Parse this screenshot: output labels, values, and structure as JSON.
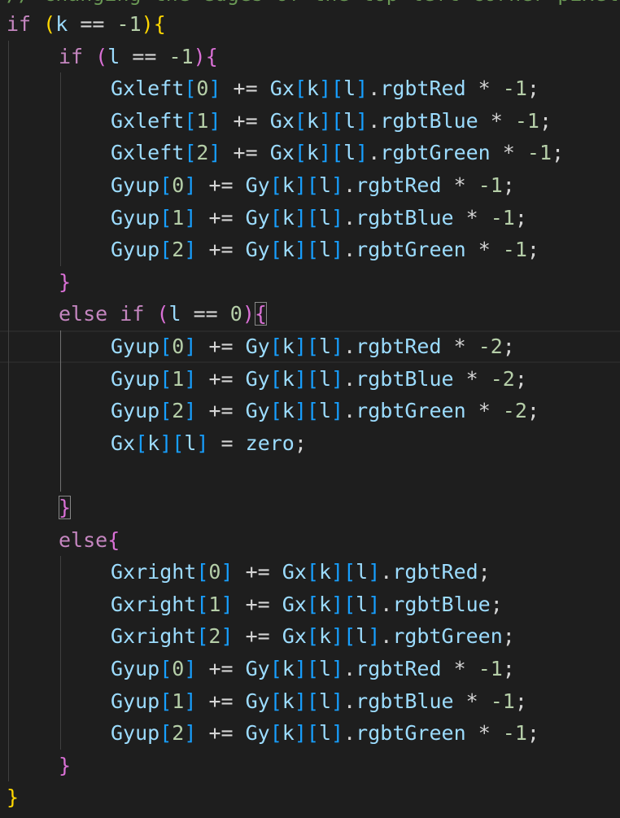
{
  "editor": {
    "top_comment": "// changing the edges of the top left corner pixel to be equal to zero",
    "colors": {
      "background": "#1e1e1e",
      "keyword_control": "#c586c0",
      "variable": "#9cdcfe",
      "number": "#b5cea8",
      "bracket_level_1": "#ffd700",
      "bracket_level_2": "#da70d6",
      "bracket_level_3": "#179fff"
    },
    "lines": [
      [
        [
          "if",
          "kw-ctrl"
        ],
        [
          " ",
          "op"
        ],
        [
          "(",
          "b1"
        ],
        [
          "k",
          "var"
        ],
        [
          " == ",
          "op"
        ],
        [
          "-1",
          "num"
        ],
        [
          ")",
          "b1"
        ],
        [
          "{",
          "b1"
        ]
      ],
      [
        [
          "if",
          "kw-ctrl"
        ],
        [
          " ",
          "op"
        ],
        [
          "(",
          "b2"
        ],
        [
          "l",
          "var"
        ],
        [
          " == ",
          "op"
        ],
        [
          "-1",
          "num"
        ],
        [
          ")",
          "b2"
        ],
        [
          "{",
          "b2"
        ]
      ],
      [
        [
          "Gxleft",
          "var"
        ],
        [
          "[",
          "b3"
        ],
        [
          "0",
          "num"
        ],
        [
          "]",
          "b3"
        ],
        [
          " += ",
          "op"
        ],
        [
          "Gx",
          "var"
        ],
        [
          "[",
          "b3"
        ],
        [
          "k",
          "var"
        ],
        [
          "]",
          "b3"
        ],
        [
          "[",
          "b3"
        ],
        [
          "l",
          "var"
        ],
        [
          "]",
          "b3"
        ],
        [
          ".",
          "op"
        ],
        [
          "rgbtRed",
          "var"
        ],
        [
          " * ",
          "op"
        ],
        [
          "-1",
          "num"
        ],
        [
          ";",
          "op"
        ]
      ],
      [
        [
          "Gxleft",
          "var"
        ],
        [
          "[",
          "b3"
        ],
        [
          "1",
          "num"
        ],
        [
          "]",
          "b3"
        ],
        [
          " += ",
          "op"
        ],
        [
          "Gx",
          "var"
        ],
        [
          "[",
          "b3"
        ],
        [
          "k",
          "var"
        ],
        [
          "]",
          "b3"
        ],
        [
          "[",
          "b3"
        ],
        [
          "l",
          "var"
        ],
        [
          "]",
          "b3"
        ],
        [
          ".",
          "op"
        ],
        [
          "rgbtBlue",
          "var"
        ],
        [
          " * ",
          "op"
        ],
        [
          "-1",
          "num"
        ],
        [
          ";",
          "op"
        ]
      ],
      [
        [
          "Gxleft",
          "var"
        ],
        [
          "[",
          "b3"
        ],
        [
          "2",
          "num"
        ],
        [
          "]",
          "b3"
        ],
        [
          " += ",
          "op"
        ],
        [
          "Gx",
          "var"
        ],
        [
          "[",
          "b3"
        ],
        [
          "k",
          "var"
        ],
        [
          "]",
          "b3"
        ],
        [
          "[",
          "b3"
        ],
        [
          "l",
          "var"
        ],
        [
          "]",
          "b3"
        ],
        [
          ".",
          "op"
        ],
        [
          "rgbtGreen",
          "var"
        ],
        [
          " * ",
          "op"
        ],
        [
          "-1",
          "num"
        ],
        [
          ";",
          "op"
        ]
      ],
      [
        [
          "Gyup",
          "var"
        ],
        [
          "[",
          "b3"
        ],
        [
          "0",
          "num"
        ],
        [
          "]",
          "b3"
        ],
        [
          " += ",
          "op"
        ],
        [
          "Gy",
          "var"
        ],
        [
          "[",
          "b3"
        ],
        [
          "k",
          "var"
        ],
        [
          "]",
          "b3"
        ],
        [
          "[",
          "b3"
        ],
        [
          "l",
          "var"
        ],
        [
          "]",
          "b3"
        ],
        [
          ".",
          "op"
        ],
        [
          "rgbtRed",
          "var"
        ],
        [
          " * ",
          "op"
        ],
        [
          "-1",
          "num"
        ],
        [
          ";",
          "op"
        ]
      ],
      [
        [
          "Gyup",
          "var"
        ],
        [
          "[",
          "b3"
        ],
        [
          "1",
          "num"
        ],
        [
          "]",
          "b3"
        ],
        [
          " += ",
          "op"
        ],
        [
          "Gy",
          "var"
        ],
        [
          "[",
          "b3"
        ],
        [
          "k",
          "var"
        ],
        [
          "]",
          "b3"
        ],
        [
          "[",
          "b3"
        ],
        [
          "l",
          "var"
        ],
        [
          "]",
          "b3"
        ],
        [
          ".",
          "op"
        ],
        [
          "rgbtBlue",
          "var"
        ],
        [
          " * ",
          "op"
        ],
        [
          "-1",
          "num"
        ],
        [
          ";",
          "op"
        ]
      ],
      [
        [
          "Gyup",
          "var"
        ],
        [
          "[",
          "b3"
        ],
        [
          "2",
          "num"
        ],
        [
          "]",
          "b3"
        ],
        [
          " += ",
          "op"
        ],
        [
          "Gy",
          "var"
        ],
        [
          "[",
          "b3"
        ],
        [
          "k",
          "var"
        ],
        [
          "]",
          "b3"
        ],
        [
          "[",
          "b3"
        ],
        [
          "l",
          "var"
        ],
        [
          "]",
          "b3"
        ],
        [
          ".",
          "op"
        ],
        [
          "rgbtGreen",
          "var"
        ],
        [
          " * ",
          "op"
        ],
        [
          "-1",
          "num"
        ],
        [
          ";",
          "op"
        ]
      ],
      [
        [
          "}",
          "b2"
        ]
      ],
      [
        [
          "else",
          "kw-ctrl"
        ],
        [
          " ",
          "op"
        ],
        [
          "if",
          "kw-ctrl"
        ],
        [
          " ",
          "op"
        ],
        [
          "(",
          "b2"
        ],
        [
          "l",
          "var"
        ],
        [
          " == ",
          "op"
        ],
        [
          "0",
          "num"
        ],
        [
          ")",
          "b2"
        ],
        [
          "{",
          "b2 bracket-match"
        ]
      ],
      [
        [
          "Gyup",
          "var"
        ],
        [
          "[",
          "b3"
        ],
        [
          "0",
          "num"
        ],
        [
          "]",
          "b3"
        ],
        [
          " += ",
          "op"
        ],
        [
          "Gy",
          "var"
        ],
        [
          "[",
          "b3"
        ],
        [
          "k",
          "var"
        ],
        [
          "]",
          "b3"
        ],
        [
          "[",
          "b3"
        ],
        [
          "l",
          "var"
        ],
        [
          "]",
          "b3"
        ],
        [
          ".",
          "op"
        ],
        [
          "rgbtRed",
          "var"
        ],
        [
          " * ",
          "op"
        ],
        [
          "-2",
          "num"
        ],
        [
          ";",
          "op"
        ]
      ],
      [
        [
          "Gyup",
          "var"
        ],
        [
          "[",
          "b3"
        ],
        [
          "1",
          "num"
        ],
        [
          "]",
          "b3"
        ],
        [
          " += ",
          "op"
        ],
        [
          "Gy",
          "var"
        ],
        [
          "[",
          "b3"
        ],
        [
          "k",
          "var"
        ],
        [
          "]",
          "b3"
        ],
        [
          "[",
          "b3"
        ],
        [
          "l",
          "var"
        ],
        [
          "]",
          "b3"
        ],
        [
          ".",
          "op"
        ],
        [
          "rgbtBlue",
          "var"
        ],
        [
          " * ",
          "op"
        ],
        [
          "-2",
          "num"
        ],
        [
          ";",
          "op"
        ]
      ],
      [
        [
          "Gyup",
          "var"
        ],
        [
          "[",
          "b3"
        ],
        [
          "2",
          "num"
        ],
        [
          "]",
          "b3"
        ],
        [
          " += ",
          "op"
        ],
        [
          "Gy",
          "var"
        ],
        [
          "[",
          "b3"
        ],
        [
          "k",
          "var"
        ],
        [
          "]",
          "b3"
        ],
        [
          "[",
          "b3"
        ],
        [
          "l",
          "var"
        ],
        [
          "]",
          "b3"
        ],
        [
          ".",
          "op"
        ],
        [
          "rgbtGreen",
          "var"
        ],
        [
          " * ",
          "op"
        ],
        [
          "-2",
          "num"
        ],
        [
          ";",
          "op"
        ]
      ],
      [
        [
          "Gx",
          "var"
        ],
        [
          "[",
          "b3"
        ],
        [
          "k",
          "var"
        ],
        [
          "]",
          "b3"
        ],
        [
          "[",
          "b3"
        ],
        [
          "l",
          "var"
        ],
        [
          "]",
          "b3"
        ],
        [
          " = ",
          "op"
        ],
        [
          "zero",
          "var"
        ],
        [
          ";",
          "op"
        ]
      ],
      [],
      [
        [
          "}",
          "b2 bracket-match"
        ]
      ],
      [
        [
          "else",
          "kw-ctrl"
        ],
        [
          "{",
          "b2"
        ]
      ],
      [
        [
          "Gxright",
          "var"
        ],
        [
          "[",
          "b3"
        ],
        [
          "0",
          "num"
        ],
        [
          "]",
          "b3"
        ],
        [
          " += ",
          "op"
        ],
        [
          "Gx",
          "var"
        ],
        [
          "[",
          "b3"
        ],
        [
          "k",
          "var"
        ],
        [
          "]",
          "b3"
        ],
        [
          "[",
          "b3"
        ],
        [
          "l",
          "var"
        ],
        [
          "]",
          "b3"
        ],
        [
          ".",
          "op"
        ],
        [
          "rgbtRed",
          "var"
        ],
        [
          ";",
          "op"
        ]
      ],
      [
        [
          "Gxright",
          "var"
        ],
        [
          "[",
          "b3"
        ],
        [
          "1",
          "num"
        ],
        [
          "]",
          "b3"
        ],
        [
          " += ",
          "op"
        ],
        [
          "Gx",
          "var"
        ],
        [
          "[",
          "b3"
        ],
        [
          "k",
          "var"
        ],
        [
          "]",
          "b3"
        ],
        [
          "[",
          "b3"
        ],
        [
          "l",
          "var"
        ],
        [
          "]",
          "b3"
        ],
        [
          ".",
          "op"
        ],
        [
          "rgbtBlue",
          "var"
        ],
        [
          ";",
          "op"
        ]
      ],
      [
        [
          "Gxright",
          "var"
        ],
        [
          "[",
          "b3"
        ],
        [
          "2",
          "num"
        ],
        [
          "]",
          "b3"
        ],
        [
          " += ",
          "op"
        ],
        [
          "Gx",
          "var"
        ],
        [
          "[",
          "b3"
        ],
        [
          "k",
          "var"
        ],
        [
          "]",
          "b3"
        ],
        [
          "[",
          "b3"
        ],
        [
          "l",
          "var"
        ],
        [
          "]",
          "b3"
        ],
        [
          ".",
          "op"
        ],
        [
          "rgbtGreen",
          "var"
        ],
        [
          ";",
          "op"
        ]
      ],
      [
        [
          "Gyup",
          "var"
        ],
        [
          "[",
          "b3"
        ],
        [
          "0",
          "num"
        ],
        [
          "]",
          "b3"
        ],
        [
          " += ",
          "op"
        ],
        [
          "Gy",
          "var"
        ],
        [
          "[",
          "b3"
        ],
        [
          "k",
          "var"
        ],
        [
          "]",
          "b3"
        ],
        [
          "[",
          "b3"
        ],
        [
          "l",
          "var"
        ],
        [
          "]",
          "b3"
        ],
        [
          ".",
          "op"
        ],
        [
          "rgbtRed",
          "var"
        ],
        [
          " * ",
          "op"
        ],
        [
          "-1",
          "num"
        ],
        [
          ";",
          "op"
        ]
      ],
      [
        [
          "Gyup",
          "var"
        ],
        [
          "[",
          "b3"
        ],
        [
          "1",
          "num"
        ],
        [
          "]",
          "b3"
        ],
        [
          " += ",
          "op"
        ],
        [
          "Gy",
          "var"
        ],
        [
          "[",
          "b3"
        ],
        [
          "k",
          "var"
        ],
        [
          "]",
          "b3"
        ],
        [
          "[",
          "b3"
        ],
        [
          "l",
          "var"
        ],
        [
          "]",
          "b3"
        ],
        [
          ".",
          "op"
        ],
        [
          "rgbtBlue",
          "var"
        ],
        [
          " * ",
          "op"
        ],
        [
          "-1",
          "num"
        ],
        [
          ";",
          "op"
        ]
      ],
      [
        [
          "Gyup",
          "var"
        ],
        [
          "[",
          "b3"
        ],
        [
          "2",
          "num"
        ],
        [
          "]",
          "b3"
        ],
        [
          " += ",
          "op"
        ],
        [
          "Gy",
          "var"
        ],
        [
          "[",
          "b3"
        ],
        [
          "k",
          "var"
        ],
        [
          "]",
          "b3"
        ],
        [
          "[",
          "b3"
        ],
        [
          "l",
          "var"
        ],
        [
          "]",
          "b3"
        ],
        [
          ".",
          "op"
        ],
        [
          "rgbtGreen",
          "var"
        ],
        [
          " * ",
          "op"
        ],
        [
          "-1",
          "num"
        ],
        [
          ";",
          "op"
        ]
      ],
      [
        [
          "}",
          "b2"
        ]
      ],
      [
        [
          "}",
          "b1"
        ]
      ]
    ]
  }
}
